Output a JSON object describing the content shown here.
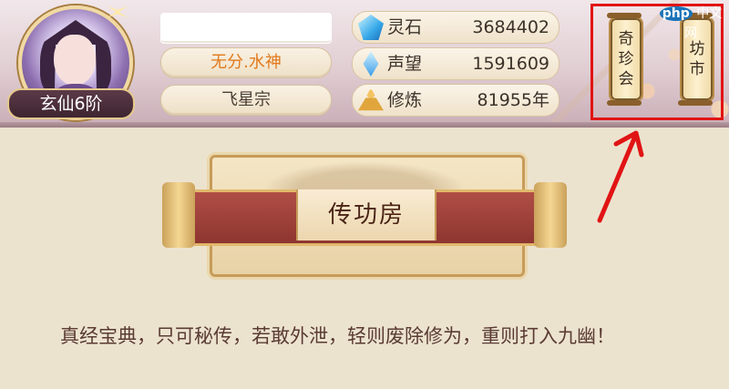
{
  "player": {
    "rank": "玄仙6阶",
    "name": "",
    "title": "无分.水神",
    "sect": "飞星宗"
  },
  "resources": [
    {
      "icon": "spirit-stone-icon",
      "label": "灵石",
      "value": "3684402"
    },
    {
      "icon": "prestige-icon",
      "label": "声望",
      "value": "1591609"
    },
    {
      "icon": "cultivation-icon",
      "label": "修炼",
      "value": "81955年"
    }
  ],
  "shortcuts": {
    "qizhen": {
      "chars": [
        "奇",
        "珍",
        "会"
      ]
    },
    "fangshi": {
      "chars": [
        "坊",
        "市"
      ]
    }
  },
  "watermark": {
    "php": "php",
    "text": "中文网"
  },
  "banner": {
    "title": "传功房"
  },
  "description": "真经宝典，只可秘传，若敢外泄，轻则废除修为，重则打入九幽！",
  "colors": {
    "highlight": "#e11414",
    "title_orange": "#e1791b",
    "banner_red": "#a0423c"
  }
}
